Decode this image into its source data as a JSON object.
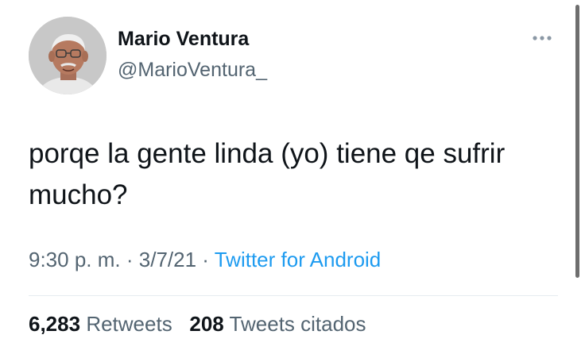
{
  "user": {
    "display_name": "Mario Ventura",
    "handle": "@MarioVentura_"
  },
  "tweet": {
    "text": "porqe la gente linda (yo) tiene qe sufrir mucho?",
    "time": "9:30 p. m.",
    "separator": "·",
    "date": "3/7/21",
    "source": "Twitter for Android"
  },
  "stats": {
    "retweets_count": "6,283",
    "retweets_label": "Retweets",
    "quotes_count": "208",
    "quotes_label": "Tweets citados"
  },
  "icons": {
    "more": "more-horizontal-icon"
  },
  "colors": {
    "primary_text": "#0f1419",
    "secondary_text": "#536471",
    "link": "#1d9bf0"
  }
}
